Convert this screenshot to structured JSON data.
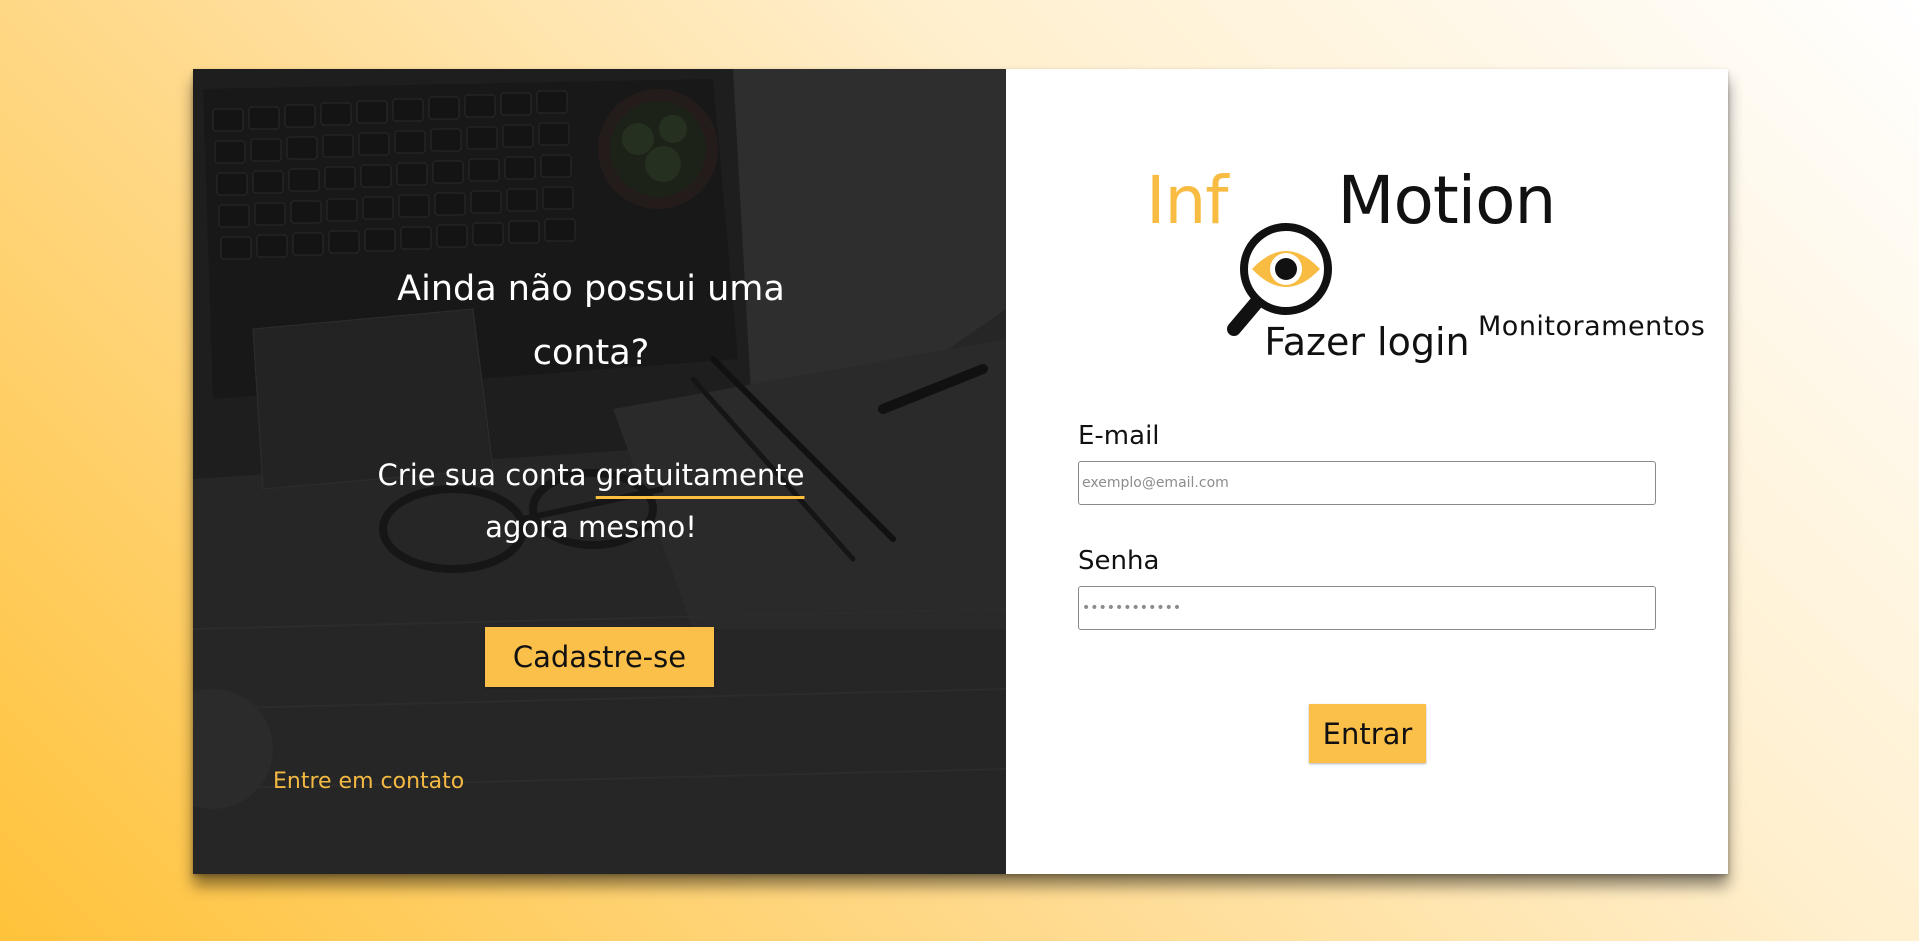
{
  "promo": {
    "title": "Ainda não possui uma conta?",
    "subtitle_part1": "Crie sua conta ",
    "subtitle_highlight": "gratuitamente",
    "subtitle_part2": " agora mesmo!",
    "signup_label": "Cadastre-se",
    "contact_label": "Entre em contato"
  },
  "logo": {
    "left": "Inf",
    "right": "Motion",
    "sub": "Monitoramentos"
  },
  "login": {
    "title": "Fazer login",
    "email_label": "E-mail",
    "email_placeholder": "exemplo@email.com",
    "password_label": "Senha",
    "password_placeholder": "••••••••••••",
    "submit_label": "Entrar"
  },
  "colors": {
    "accent": "#fbc04a",
    "panel_dark": "#262626"
  }
}
